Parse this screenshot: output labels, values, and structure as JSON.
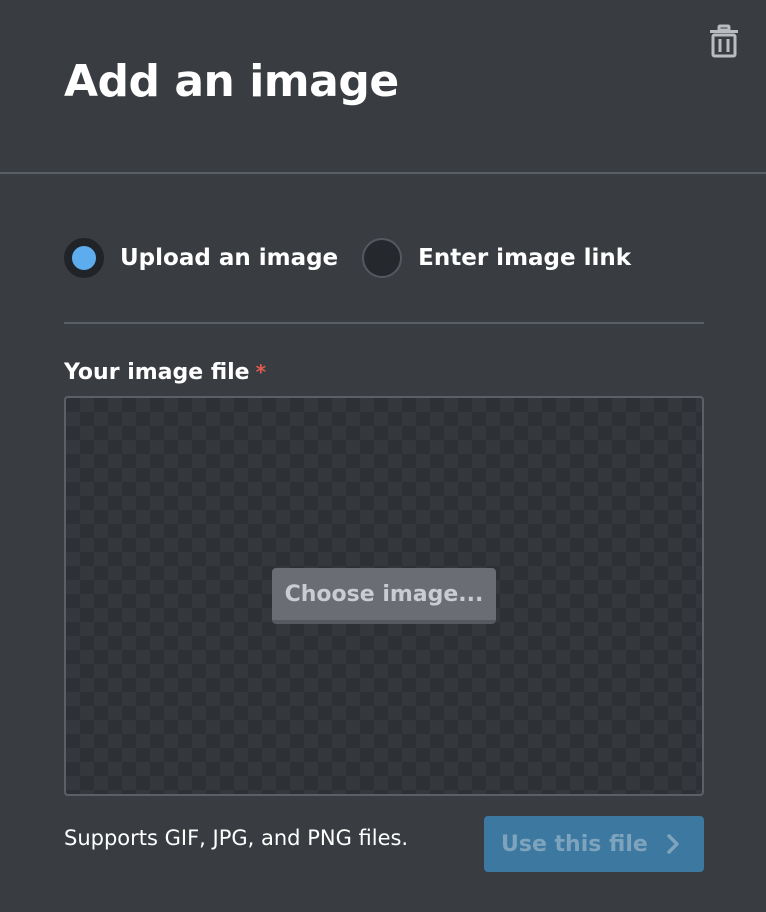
{
  "dialog": {
    "title": "Add an image",
    "delete_icon": "trash-icon"
  },
  "source": {
    "selected": "upload",
    "options": [
      {
        "id": "upload",
        "label": "Upload an image",
        "checked": true
      },
      {
        "id": "link",
        "label": "Enter image link",
        "checked": false
      }
    ]
  },
  "file_field": {
    "label": "Your image file",
    "required_mark": "*",
    "choose_button_label": "Choose image...",
    "help_text": "Supports GIF, JPG, and PNG files."
  },
  "actions": {
    "use_file_label": "Use this file",
    "use_file_icon": "chevron-right-icon"
  },
  "colors": {
    "background": "#393d42",
    "accent": "#5cacee",
    "primary_button": "#3c78a0",
    "required": "#e05a4f"
  }
}
